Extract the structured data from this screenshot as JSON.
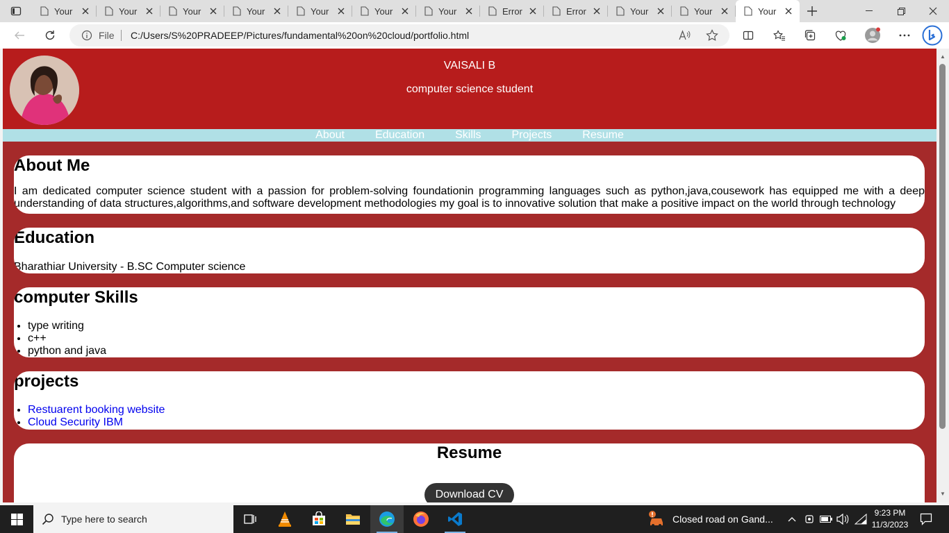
{
  "browser": {
    "tabs": [
      {
        "label": "Your"
      },
      {
        "label": "Your"
      },
      {
        "label": "Your"
      },
      {
        "label": "Your"
      },
      {
        "label": "Your"
      },
      {
        "label": "Your"
      },
      {
        "label": "Your"
      },
      {
        "label": "Error"
      },
      {
        "label": "Error"
      },
      {
        "label": "Your"
      },
      {
        "label": "Your"
      },
      {
        "label": "Your",
        "active": true
      }
    ],
    "address_scheme": "File",
    "address_url": "C:/Users/S%20PRADEEP/Pictures/fundamental%20on%20cloud/portfolio.html"
  },
  "site": {
    "name": "VAISALI B",
    "role": "computer science student",
    "nav": [
      "About",
      "Education",
      "Skills",
      "Projects",
      "Resume"
    ],
    "about": {
      "title": "About Me",
      "text": "I am dedicated computer science student with a passion for problem-solving foundationin programming languages such as python,java,cousework has equipped me with a deep understanding of data structures,algorithms,and software development methodologies my goal is to innovative solution that make a positive impact on the world through technology"
    },
    "education": {
      "title": "Education",
      "text": "Bharathiar University - B.SC Computer science"
    },
    "skills": {
      "title": "computer Skills",
      "items": [
        "type writing",
        "c++",
        "python and java"
      ]
    },
    "projects": {
      "title": "projects",
      "items": [
        "Restuarent booking website",
        "Cloud Security IBM"
      ]
    },
    "resume": {
      "title": "Resume",
      "button": "Download CV"
    }
  },
  "taskbar": {
    "search_placeholder": "Type here to search",
    "news": "Closed road on Gand...",
    "time": "9:23 PM",
    "date": "11/3/2023"
  },
  "colors": {
    "page_bg": "#a52a2a",
    "header_bg": "#b71c1c",
    "nav_bg": "#b0e0e6",
    "button_bg": "#333333"
  }
}
